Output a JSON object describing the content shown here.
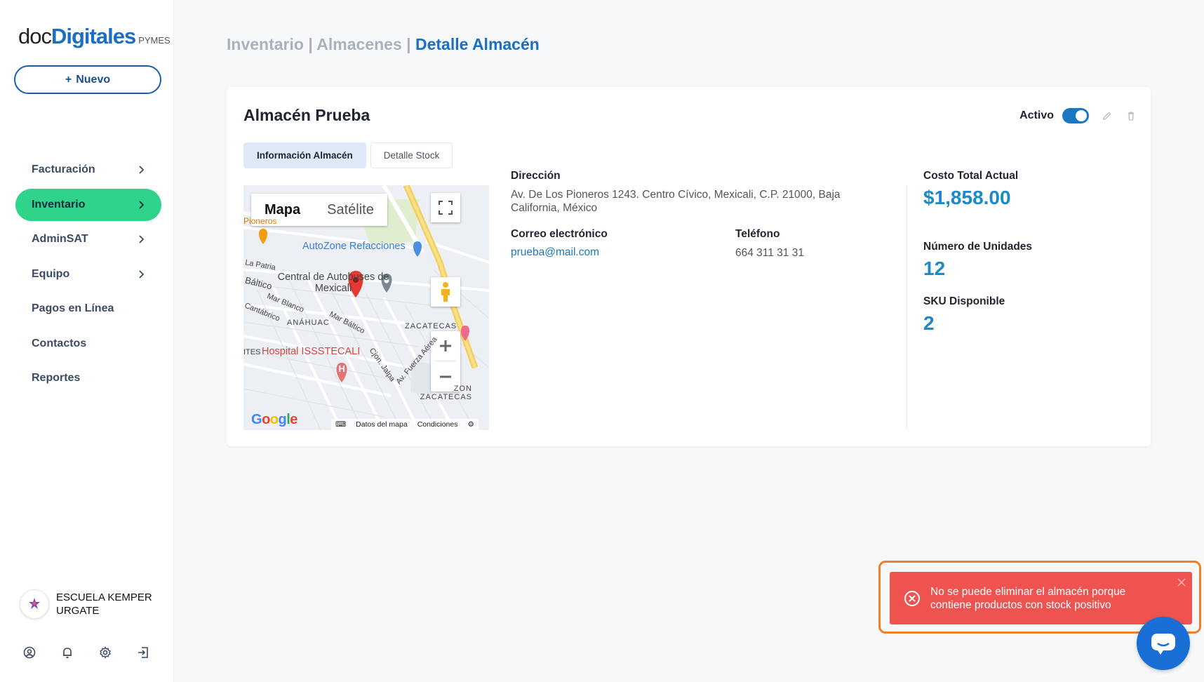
{
  "brand": {
    "doc": "doc",
    "digitales": "Digitales",
    "pymes": "PYMES"
  },
  "sidebar": {
    "new_button": "Nuevo",
    "items": [
      {
        "label": "Facturación",
        "has_chevron": true,
        "active": false
      },
      {
        "label": "Inventario",
        "has_chevron": true,
        "active": true
      },
      {
        "label": "AdminSAT",
        "has_chevron": true,
        "active": false
      },
      {
        "label": "Equipo",
        "has_chevron": true,
        "active": false
      },
      {
        "label": "Pagos en Línea",
        "has_chevron": false,
        "active": false
      },
      {
        "label": "Contactos",
        "has_chevron": false,
        "active": false
      },
      {
        "label": "Reportes",
        "has_chevron": false,
        "active": false
      }
    ],
    "account_name": "ESCUELA KEMPER URGATE",
    "bottom_icons": [
      "user-circle-icon",
      "bell-icon",
      "gear-icon",
      "logout-icon"
    ]
  },
  "breadcrumb": {
    "part1": "Inventario",
    "part2": "Almacenes",
    "separator": "|",
    "current": "Detalle Almacén"
  },
  "warehouse": {
    "title": "Almacén Prueba",
    "status_label": "Activo",
    "status_on": true,
    "tabs": [
      "Información Almacén",
      "Detalle Stock"
    ],
    "address_label": "Dirección",
    "address": "Av. De Los Pioneros 1243. Centro Cívico, Mexicali, C.P. 21000, Baja California, México",
    "email_label": "Correo electrónico",
    "email": "prueba@mail.com",
    "phone_label": "Teléfono",
    "phone": "664 311 31 31",
    "stats": {
      "cost_label": "Costo Total Actual",
      "cost": "$1,858.00",
      "units_label": "Número de Unidades",
      "units": "12",
      "sku_label": "SKU Disponible",
      "sku": "2"
    }
  },
  "map": {
    "type_map": "Mapa",
    "type_satellite": "Satélite",
    "labels": {
      "autozone": "AutoZone Refacciones",
      "central": "Central de Autobuses de Mexicali",
      "hospital": "Hospital ISSSTECALI",
      "anahuac": "ANÁHUAC",
      "zacatecas": "ZACATECAS",
      "zon_zacatecas": "ZON ZACATECAS",
      "baltico": "Báltico",
      "la_patria": "La Patria",
      "mar_blanco": "Mar Blanco",
      "cantabrico": "Cantábrico",
      "mar_baltico": "Mar Báltico",
      "pioneros": "Pioneros",
      "ites": "ITES",
      "cjon_jalpa": "Cjon. Jalpa",
      "av_fuerza": "Av. Fuerza Aérea"
    },
    "footer_data": "Datos del mapa",
    "footer_terms": "Condiciones",
    "google": "Google"
  },
  "toast": {
    "message": "No se puede eliminar el almacén porque contiene productos con stock positivo",
    "color": "#ee5350"
  },
  "colors": {
    "accent": "#1a6fc4",
    "active_nav": "#2fd48a",
    "stat": "#1a8ac8"
  }
}
